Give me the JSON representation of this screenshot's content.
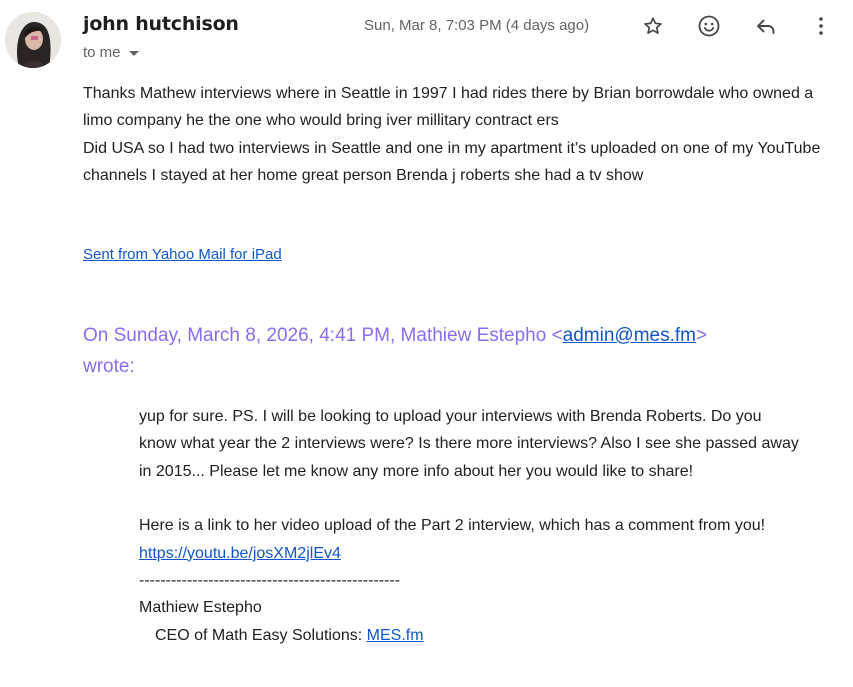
{
  "message": {
    "sender_name": "john hutchison",
    "recipient_label": "to me",
    "date": "Sun, Mar 8, 7:03 PM (4 days ago)",
    "actions": {
      "star_icon": "star-icon",
      "react_icon": "emoji-icon",
      "reply_icon": "reply-icon",
      "more_icon": "more-vert-icon"
    },
    "body": "Thanks Mathew interviews where in Seattle in 1997 I had rides there by Brian borrowdale who owned a limo company he the one who would bring iver millitary contract ers\nDid USA  so I had two interviews in Seattle and one in my apartment it’s uploaded on one of my YouTube channels I stayed at her home great person Brenda j roberts she had a tv show",
    "signature_link": "Sent from Yahoo Mail for iPad"
  },
  "quote": {
    "header_prefix": "On Sunday, March 8, 2026, 4:41 PM, Mathiew Estepho <",
    "email": "admin@mes.fm",
    "header_suffix": ">",
    "wrote": "wrote:",
    "para1": "yup for sure. PS. I will be looking to upload your interviews with Brenda Roberts. Do you know what year the 2 interviews were? Is there more interviews? Also I see she passed away in 2015... Please let me know any more info about her you would like to share!",
    "para2": "Here is a link to her video upload of the Part 2 interview, which has a comment from you!",
    "video_link": "https://youtu.be/josXM2jlEv4",
    "divider": "-------------------------------------------------",
    "sig_name": "Mathiew Estepho",
    "sig_title": "CEO of Math Easy Solutions:",
    "sig_link": "MES.fm"
  },
  "colors": {
    "quote_header": "#8b6cf0",
    "link": "#1155cc"
  }
}
